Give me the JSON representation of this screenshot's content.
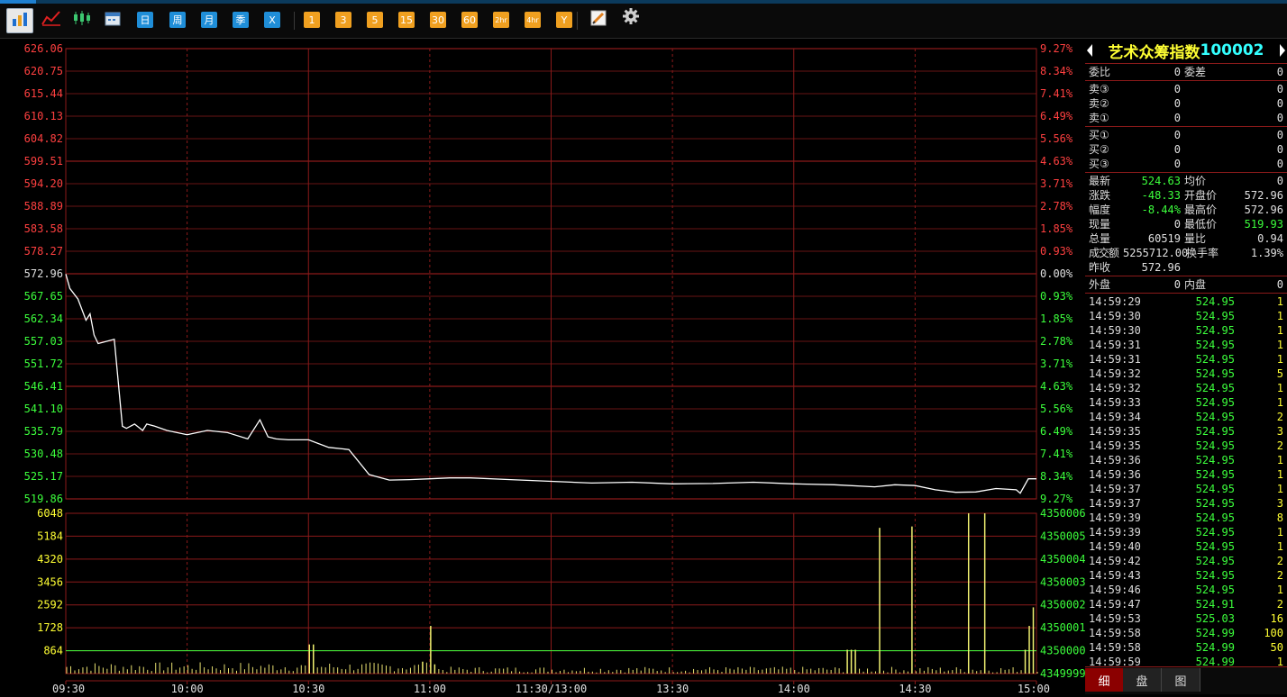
{
  "toolbar": {
    "buttons": [
      {
        "kind": "icon",
        "icon": "bar-chart-icon"
      },
      {
        "kind": "icon",
        "icon": "line-chart-icon"
      },
      {
        "kind": "icon",
        "icon": "candlestick-icon"
      },
      {
        "kind": "icon",
        "icon": "calendar-icon"
      },
      {
        "kind": "blue",
        "label": "日"
      },
      {
        "kind": "blue",
        "label": "周"
      },
      {
        "kind": "blue",
        "label": "月"
      },
      {
        "kind": "blue",
        "label": "季"
      },
      {
        "kind": "blue",
        "label": "X"
      },
      {
        "kind": "orange",
        "label": "1"
      },
      {
        "kind": "orange",
        "label": "3"
      },
      {
        "kind": "orange",
        "label": "5"
      },
      {
        "kind": "orange",
        "label": "15"
      },
      {
        "kind": "orange",
        "label": "30"
      },
      {
        "kind": "orange",
        "label": "60"
      },
      {
        "kind": "orange",
        "label": "2hr"
      },
      {
        "kind": "orange",
        "label": "4hr"
      },
      {
        "kind": "orange",
        "label": "Y"
      },
      {
        "kind": "icon",
        "icon": "pencil-draw-icon"
      },
      {
        "kind": "icon",
        "icon": "gear-icon"
      }
    ]
  },
  "chart_data": [
    {
      "type": "line",
      "price_labels": [
        "626.06",
        "620.75",
        "615.44",
        "610.13",
        "604.82",
        "599.51",
        "594.20",
        "588.89",
        "583.58",
        "578.27",
        "572.96",
        "567.65",
        "562.34",
        "557.03",
        "551.72",
        "546.41",
        "541.10",
        "535.79",
        "530.48",
        "525.17",
        "519.86"
      ],
      "pct_labels": [
        "9.27%",
        "8.34%",
        "7.41%",
        "6.49%",
        "5.56%",
        "4.63%",
        "3.71%",
        "2.78%",
        "1.85%",
        "0.93%",
        "0.00%",
        "0.93%",
        "1.85%",
        "2.78%",
        "3.71%",
        "4.63%",
        "5.56%",
        "6.49%",
        "7.41%",
        "8.34%",
        "9.27%"
      ],
      "ylim": [
        519.86,
        626.06
      ],
      "prev_close": 572.96,
      "x_labels": [
        "09:30",
        "10:00",
        "10:30",
        "11:00",
        "11:30/13:00",
        "13:30",
        "14:00",
        "14:30",
        "15:00"
      ],
      "x_range_minutes": [
        0,
        240
      ],
      "series": [
        {
          "x": [
            0,
            1,
            3,
            5,
            6,
            7,
            8,
            10,
            12,
            14,
            15,
            17,
            19,
            20,
            22,
            25,
            30,
            35,
            40,
            45,
            48,
            50,
            52,
            55,
            60,
            65,
            70,
            75,
            80,
            85,
            90,
            95,
            100,
            110,
            120,
            130,
            140,
            150,
            160,
            170,
            180,
            190,
            200,
            205,
            210,
            215,
            220,
            225,
            230,
            235,
            236,
            238,
            240
          ],
          "y": [
            572.9,
            569.5,
            567.0,
            562.0,
            563.5,
            558.5,
            556.5,
            557.0,
            557.5,
            537.0,
            536.5,
            537.5,
            536.0,
            537.5,
            537.0,
            536.0,
            535.0,
            536.0,
            535.5,
            534.0,
            538.5,
            534.5,
            534.0,
            533.8,
            533.8,
            532.0,
            531.5,
            525.6,
            524.3,
            524.4,
            524.6,
            524.8,
            524.8,
            524.4,
            524.0,
            523.6,
            523.8,
            523.4,
            523.5,
            523.8,
            523.4,
            523.2,
            522.7,
            523.2,
            523.0,
            522.0,
            521.4,
            521.5,
            522.3,
            522.0,
            521.2,
            524.6,
            524.6
          ]
        }
      ]
    },
    {
      "type": "bar",
      "volume_left_labels": [
        "6048",
        "5184",
        "4320",
        "3456",
        "2592",
        "1728",
        "864"
      ],
      "volume_right_labels": [
        "4350006",
        "4350005",
        "4350004",
        "4350003",
        "4350002",
        "4350001",
        "4350000",
        "4349999"
      ],
      "ylim": [
        0,
        6048
      ],
      "reference_line": 864,
      "x_range_minutes": [
        0,
        240
      ],
      "spikes": [
        {
          "x": 60,
          "v": 1100
        },
        {
          "x": 61,
          "v": 1100
        },
        {
          "x": 90,
          "v": 1800
        },
        {
          "x": 88,
          "v": 450
        },
        {
          "x": 91,
          "v": 350
        },
        {
          "x": 193,
          "v": 900
        },
        {
          "x": 194,
          "v": 900
        },
        {
          "x": 195,
          "v": 900
        },
        {
          "x": 201,
          "v": 5500
        },
        {
          "x": 209,
          "v": 5550
        },
        {
          "x": 223,
          "v": 6048
        },
        {
          "x": 227,
          "v": 6048
        },
        {
          "x": 238,
          "v": 1800
        },
        {
          "x": 239,
          "v": 2500
        },
        {
          "x": 237,
          "v": 900
        }
      ]
    }
  ],
  "panel": {
    "name": "艺术众筹指数",
    "code": "100002",
    "weibi": {
      "label1": "委比",
      "val1": "0",
      "label2": "委差",
      "val2": "0"
    },
    "sell": [
      {
        "label": "卖③",
        "v1": "0",
        "v2": "0"
      },
      {
        "label": "卖②",
        "v1": "0",
        "v2": "0"
      },
      {
        "label": "卖①",
        "v1": "0",
        "v2": "0"
      }
    ],
    "buy": [
      {
        "label": "买①",
        "v1": "0",
        "v2": "0"
      },
      {
        "label": "买②",
        "v1": "0",
        "v2": "0"
      },
      {
        "label": "买③",
        "v1": "0",
        "v2": "0"
      }
    ],
    "quote": [
      {
        "l1": "最新",
        "v1": "524.63",
        "c1": "g",
        "l2": "均价",
        "v2": "0",
        "c2": "w"
      },
      {
        "l1": "涨跌",
        "v1": "-48.33",
        "c1": "g",
        "l2": "开盘价",
        "v2": "572.96",
        "c2": "w"
      },
      {
        "l1": "幅度",
        "v1": "-8.44%",
        "c1": "g",
        "l2": "最高价",
        "v2": "572.96",
        "c2": "w"
      },
      {
        "l1": "现量",
        "v1": "0",
        "c1": "w",
        "l2": "最低价",
        "v2": "519.93",
        "c2": "g"
      },
      {
        "l1": "总量",
        "v1": "60519",
        "c1": "w",
        "l2": "量比",
        "v2": "0.94",
        "c2": "w"
      },
      {
        "l1": "成交额",
        "v1": "5255712.00",
        "c1": "w",
        "l2": "换手率",
        "v2": "1.39%",
        "c2": "w"
      },
      {
        "l1": "昨收",
        "v1": "572.96",
        "c1": "w",
        "l2": "",
        "v2": "",
        "c2": "w"
      }
    ],
    "outer": {
      "l1": "外盘",
      "v1": "0",
      "l2": "内盘",
      "v2": "0"
    },
    "ticks": [
      {
        "t": "14:59:29",
        "p": "524.95",
        "v": "1"
      },
      {
        "t": "14:59:30",
        "p": "524.95",
        "v": "1"
      },
      {
        "t": "14:59:30",
        "p": "524.95",
        "v": "1"
      },
      {
        "t": "14:59:31",
        "p": "524.95",
        "v": "1"
      },
      {
        "t": "14:59:31",
        "p": "524.95",
        "v": "1"
      },
      {
        "t": "14:59:32",
        "p": "524.95",
        "v": "5"
      },
      {
        "t": "14:59:32",
        "p": "524.95",
        "v": "1"
      },
      {
        "t": "14:59:33",
        "p": "524.95",
        "v": "1"
      },
      {
        "t": "14:59:34",
        "p": "524.95",
        "v": "2"
      },
      {
        "t": "14:59:35",
        "p": "524.95",
        "v": "3"
      },
      {
        "t": "14:59:35",
        "p": "524.95",
        "v": "2"
      },
      {
        "t": "14:59:36",
        "p": "524.95",
        "v": "1"
      },
      {
        "t": "14:59:36",
        "p": "524.95",
        "v": "1"
      },
      {
        "t": "14:59:37",
        "p": "524.95",
        "v": "1"
      },
      {
        "t": "14:59:37",
        "p": "524.95",
        "v": "3"
      },
      {
        "t": "14:59:39",
        "p": "524.95",
        "v": "8"
      },
      {
        "t": "14:59:39",
        "p": "524.95",
        "v": "1"
      },
      {
        "t": "14:59:40",
        "p": "524.95",
        "v": "1"
      },
      {
        "t": "14:59:42",
        "p": "524.95",
        "v": "2"
      },
      {
        "t": "14:59:43",
        "p": "524.95",
        "v": "2"
      },
      {
        "t": "14:59:46",
        "p": "524.95",
        "v": "1"
      },
      {
        "t": "14:59:47",
        "p": "524.91",
        "v": "2"
      },
      {
        "t": "14:59:53",
        "p": "525.03",
        "v": "16"
      },
      {
        "t": "14:59:58",
        "p": "524.99",
        "v": "100"
      },
      {
        "t": "14:59:58",
        "p": "524.99",
        "v": "50"
      },
      {
        "t": "14:59:59",
        "p": "524.99",
        "v": "1"
      }
    ],
    "tabs": [
      "细",
      "盘",
      "图"
    ]
  }
}
